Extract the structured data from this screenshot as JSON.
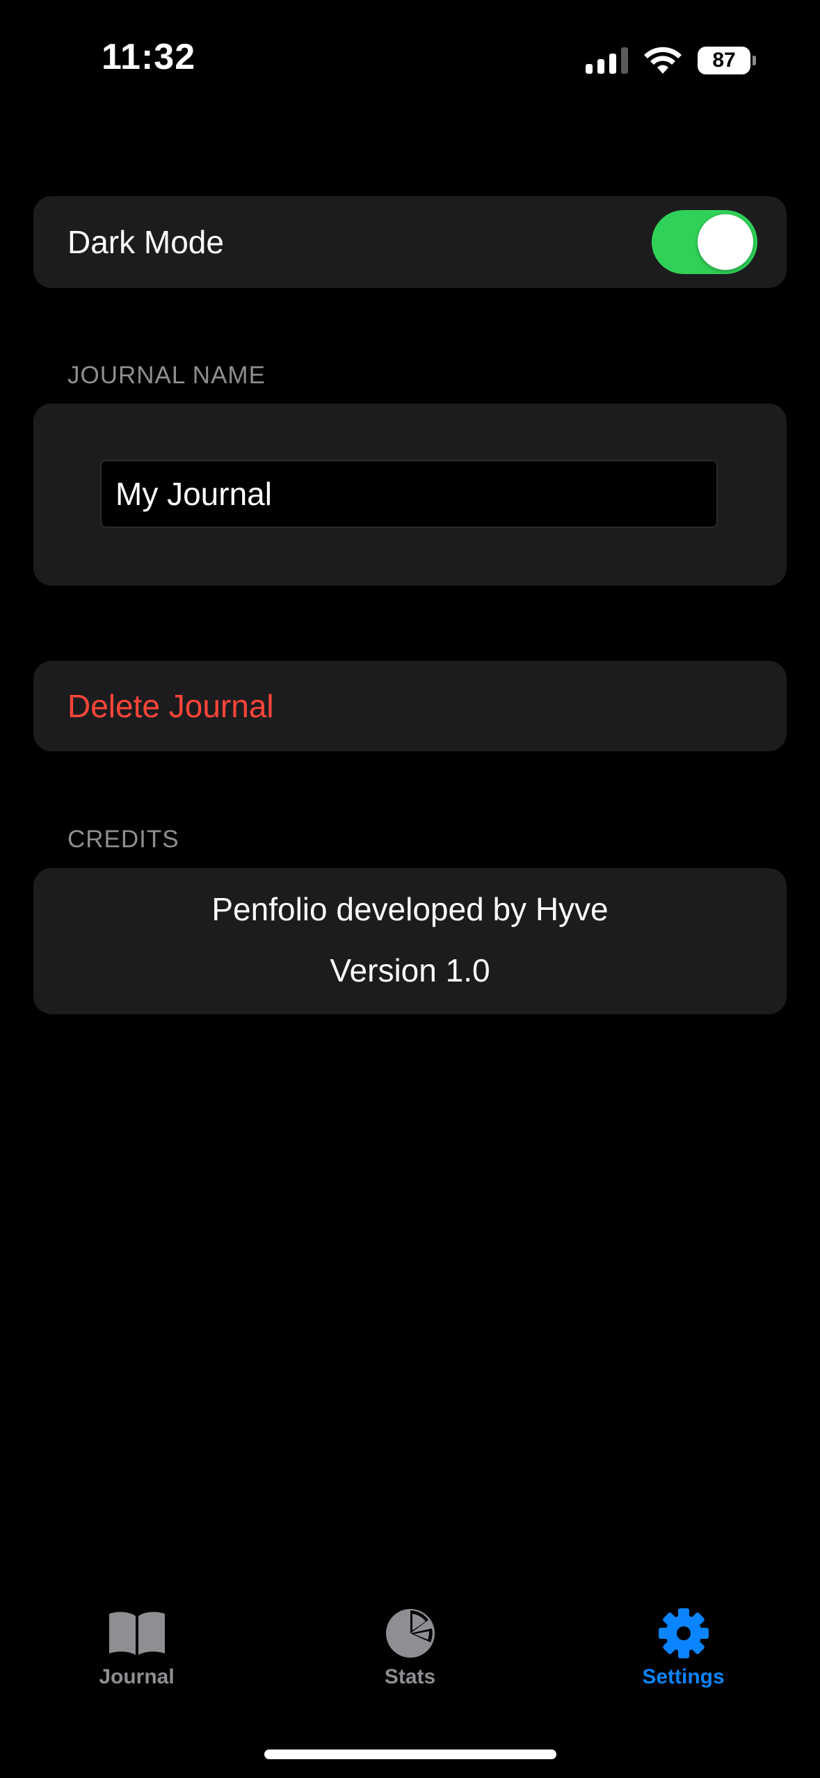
{
  "status_bar": {
    "time": "11:32",
    "battery_level": "87",
    "icons": [
      "cellular-signal-icon",
      "wifi-icon",
      "battery-icon"
    ]
  },
  "settings": {
    "dark_mode": {
      "label": "Dark Mode",
      "enabled": true
    },
    "journal_name": {
      "section_label": "JOURNAL NAME",
      "value": "My Journal"
    },
    "delete": {
      "label": "Delete Journal"
    },
    "credits": {
      "section_label": "CREDITS",
      "line1": "Penfolio developed by Hyve",
      "line2": "Version 1.0"
    }
  },
  "tab_bar": {
    "tabs": [
      {
        "label": "Journal",
        "icon": "book-icon",
        "active": false
      },
      {
        "label": "Stats",
        "icon": "pie-chart-icon",
        "active": false
      },
      {
        "label": "Settings",
        "icon": "gear-icon",
        "active": true
      }
    ]
  },
  "colors": {
    "background": "#000000",
    "card": "#1c1c1e",
    "toggle_on": "#30d158",
    "destructive": "#ff453a",
    "accent": "#0a84ff",
    "secondary_text": "#8e8e93"
  }
}
